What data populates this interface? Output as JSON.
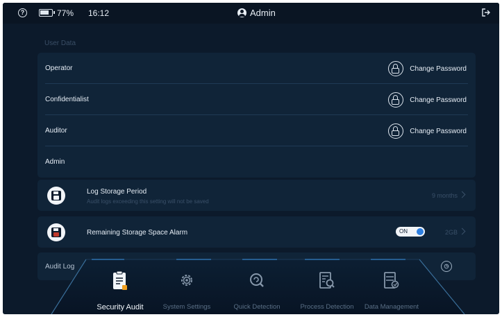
{
  "status_bar": {
    "battery_percent": "77%",
    "time": "16:12",
    "user": "Admin"
  },
  "user_data": {
    "section_label": "User Data",
    "rows": [
      {
        "name": "Operator",
        "action": "Change Password"
      },
      {
        "name": "Confidentialist",
        "action": "Change Password"
      },
      {
        "name": "Auditor",
        "action": "Change Password"
      },
      {
        "name": "Admin"
      }
    ]
  },
  "log_storage": {
    "title": "Log Storage Period",
    "subtitle": "Audit logs exceeding this setting will not be saved",
    "value": "9 months"
  },
  "storage_alarm": {
    "title": "Remaining Storage Space Alarm",
    "toggle": "ON",
    "value": "2GB"
  },
  "audit_log": {
    "label": "Audit Log"
  },
  "nav": {
    "active": "Security Audit",
    "items": [
      {
        "label": "Security Audit",
        "icon": "clipboard-icon"
      },
      {
        "label": "System Settings",
        "icon": "gear-icon"
      },
      {
        "label": "Quick Detection",
        "icon": "quick-scan-icon"
      },
      {
        "label": "Process Detection",
        "icon": "process-scan-icon"
      },
      {
        "label": "Data Management",
        "icon": "data-management-icon"
      }
    ]
  },
  "colors": {
    "background": "#0c1a2b",
    "panel": "#102438",
    "accent_blue": "#2e7fe0",
    "alert_orange": "#f0a020"
  }
}
